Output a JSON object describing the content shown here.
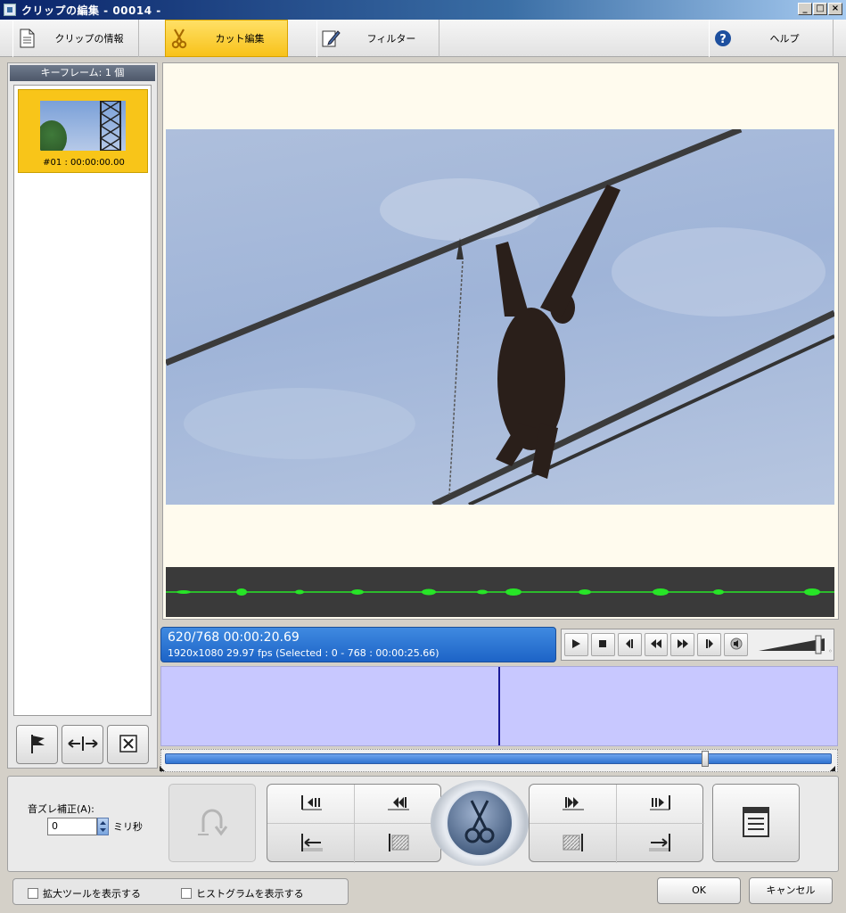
{
  "window": {
    "title": "クリップの編集 - 00014 -",
    "minimize": "_",
    "maximize": "□",
    "close": "×"
  },
  "tabs": [
    {
      "label": "クリップの情報",
      "icon": "document-icon"
    },
    {
      "label": "カット編集",
      "icon": "scissors-icon"
    },
    {
      "label": "フィルター",
      "icon": "edit-icon"
    },
    {
      "label": "ヘルプ",
      "icon": "help-icon"
    }
  ],
  "keyframes": {
    "header": "キーフレーム: 1 個",
    "items": [
      {
        "label": "#01 : 00:00:00.00"
      }
    ]
  },
  "info": {
    "main": "620/768  00:00:20.69",
    "sub": "1920x1080 29.97 fps  (Selected : 0 - 768 : 00:00:25.66)"
  },
  "transport_icons": [
    "play-icon",
    "stop-icon",
    "prev-frame-icon",
    "rewind-icon",
    "fast-forward-icon",
    "next-frame-icon",
    "speaker-icon"
  ],
  "volume": {
    "level": 0.85
  },
  "timeline": {
    "playhead_fraction": 0.807
  },
  "audio_offset": {
    "label": "音ズレ補正(A):",
    "value": "0",
    "unit": "ミリ秒"
  },
  "options": {
    "zoom_tool": "拡大ツールを表示する",
    "histogram": "ヒストグラムを表示する"
  },
  "dialog": {
    "ok": "OK",
    "cancel": "キャンセル"
  },
  "colors": {
    "active_tab": "#f8c21a",
    "info_bar": "#1d64c7",
    "timeline": "#c8c8ff",
    "waveform": "#27e427"
  }
}
